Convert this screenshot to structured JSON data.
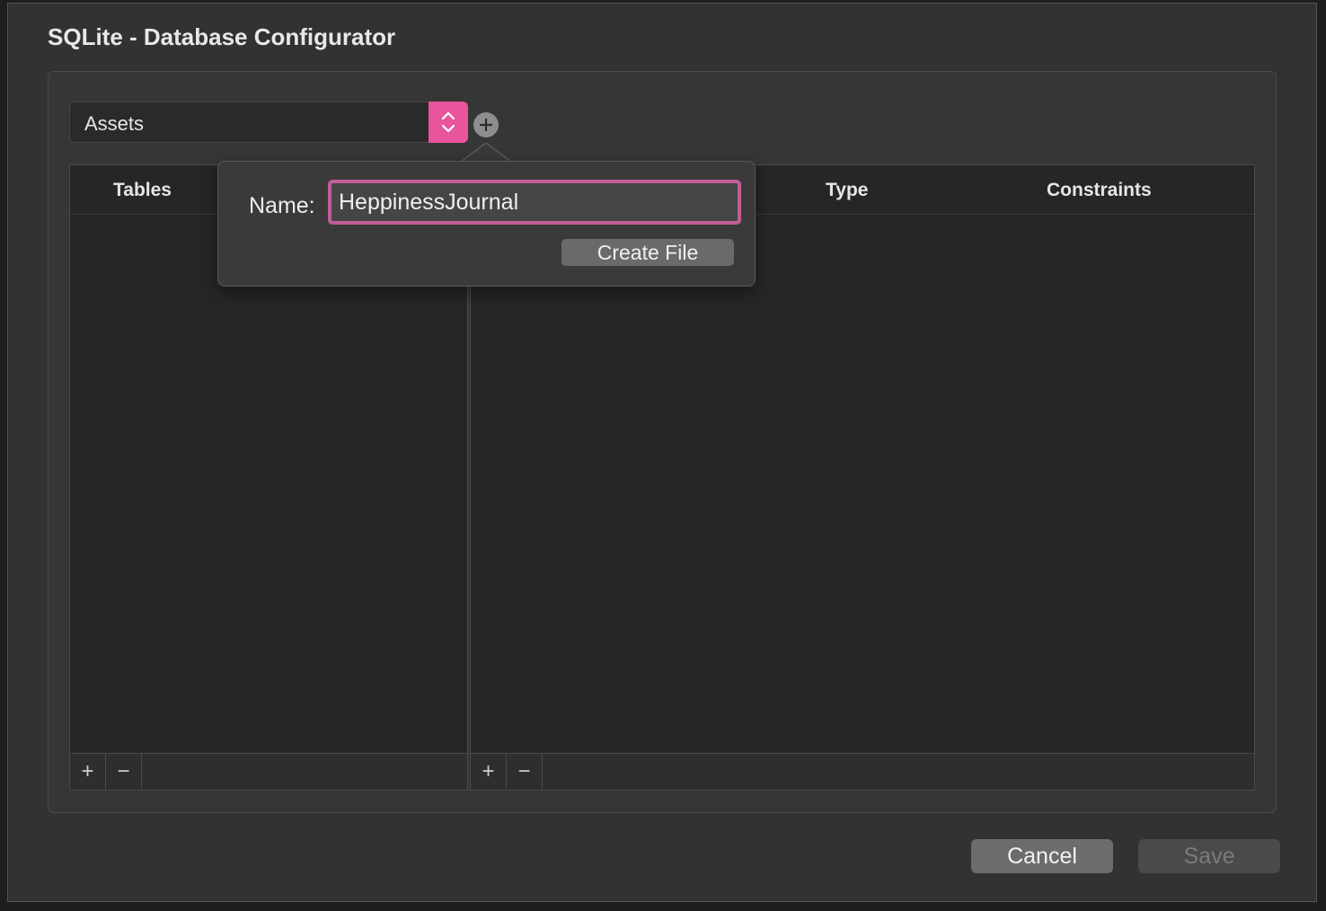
{
  "window": {
    "title": "SQLite - Database Configurator"
  },
  "database_selector": {
    "selected": "Assets",
    "add_label": "+"
  },
  "tables_panel": {
    "header": "Tables",
    "add": "+",
    "remove": "−"
  },
  "columns_panel": {
    "headers": [
      "Type",
      "Constraints"
    ],
    "add": "+",
    "remove": "−"
  },
  "new_file_popover": {
    "name_label": "Name:",
    "name_value": "HeppinessJournal",
    "create_label": "Create File"
  },
  "buttons": {
    "cancel": "Cancel",
    "save": "Save"
  },
  "colors": {
    "accent": "#e8559c",
    "focus_ring": "#c15d98"
  }
}
